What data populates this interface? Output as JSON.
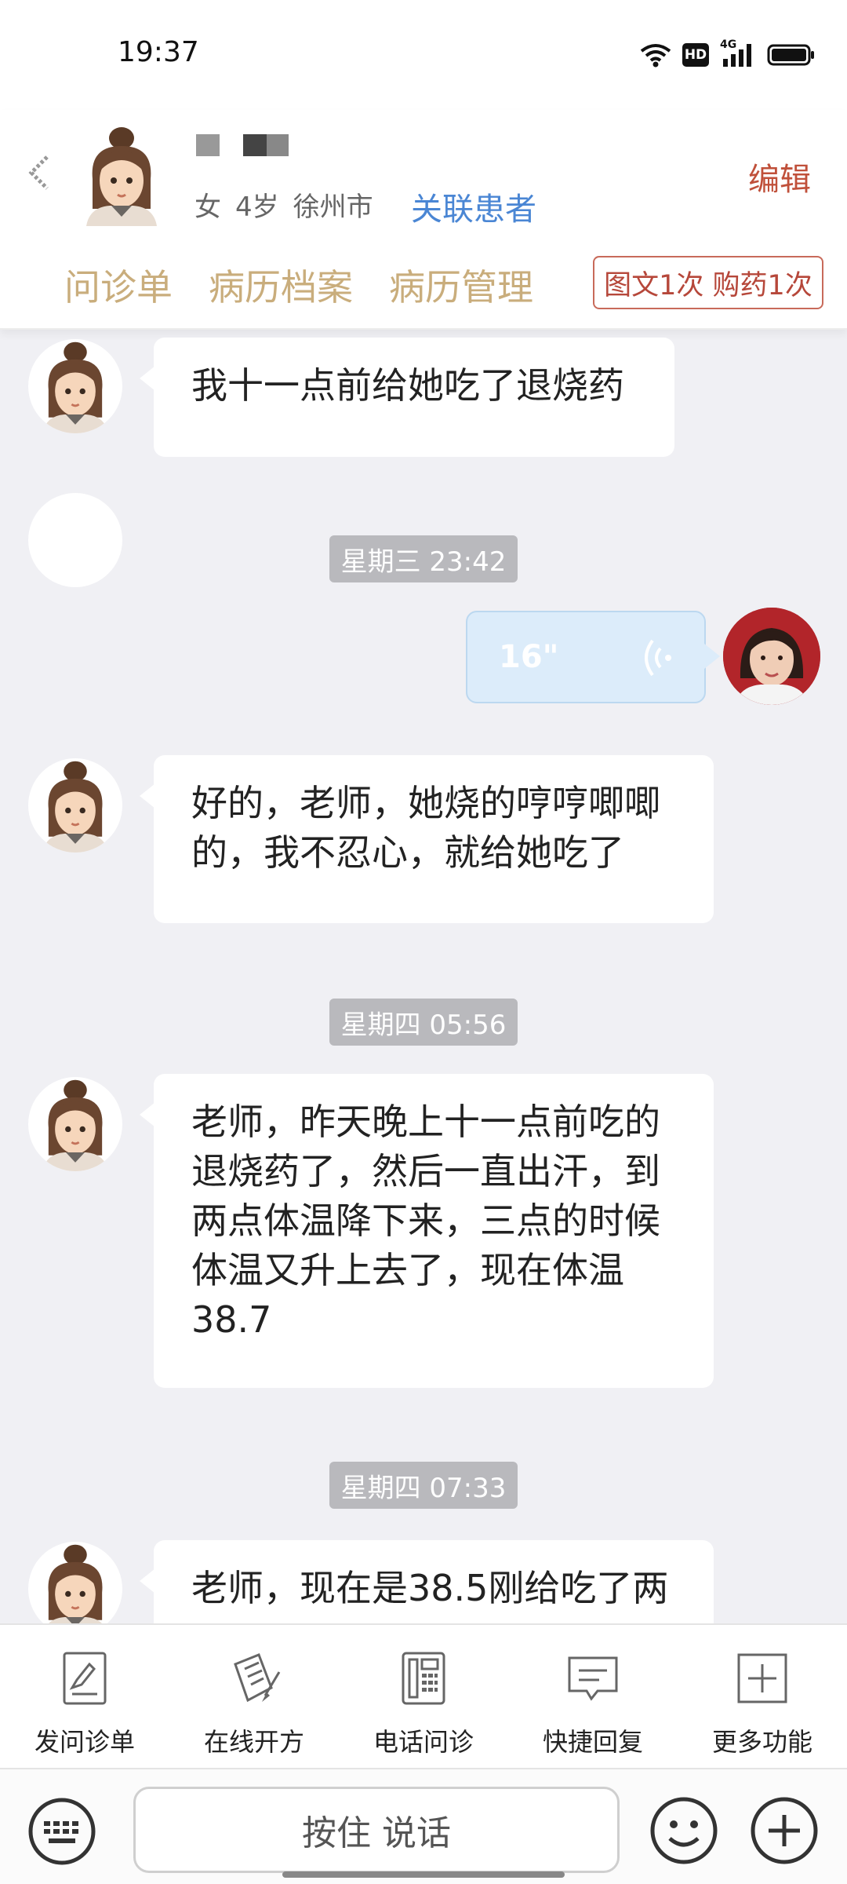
{
  "status_bar": {
    "time": "19:37",
    "icons": [
      "wifi-icon",
      "hd-icon",
      "signal-4g-icon",
      "battery-icon"
    ],
    "hd_label": "HD",
    "network_label": "4G"
  },
  "header": {
    "patient_gender": "女",
    "patient_age": "4岁",
    "patient_city": "徐州市",
    "link_patient_label": "关联患者",
    "edit_label": "编辑",
    "tabs": [
      {
        "label": "问诊单"
      },
      {
        "label": "病历档案"
      },
      {
        "label": "病历管理"
      }
    ],
    "service_badge": "图文1次 购药1次"
  },
  "chat": {
    "messages": [
      {
        "sender": "patient",
        "type": "text",
        "text_lines": [
          "我十一点前给她吃了退烧药"
        ]
      },
      {
        "type": "time",
        "text": "星期三 23:42"
      },
      {
        "sender": "doctor",
        "type": "voice",
        "duration": "16\""
      },
      {
        "sender": "patient",
        "type": "text",
        "text_lines": [
          "好的，老师，她烧的哼哼唧唧",
          "的，我不忍心，就给她吃了"
        ]
      },
      {
        "type": "time",
        "text": "星期四 05:56"
      },
      {
        "sender": "patient",
        "type": "text",
        "text_lines": [
          "老师，昨天晚上十一点前吃的",
          "退烧药了，然后一直出汗，到",
          "两点体温降下来，三点的时候",
          "体温又升上去了，现在体温",
          "38.7"
        ]
      },
      {
        "type": "time",
        "text": "星期四 07:33"
      },
      {
        "sender": "patient",
        "type": "text",
        "text_lines": [
          "老师，现在是38.5刚给吃了两"
        ]
      }
    ]
  },
  "function_bar": {
    "items": [
      {
        "label": "发问诊单",
        "icon": "questionnaire-icon"
      },
      {
        "label": "在线开方",
        "icon": "prescription-icon"
      },
      {
        "label": "电话问诊",
        "icon": "phone-icon"
      },
      {
        "label": "快捷回复",
        "icon": "quick-reply-icon"
      },
      {
        "label": "更多功能",
        "icon": "more-icon"
      }
    ]
  },
  "input_bar": {
    "hold_to_talk_label": "按住 说话"
  },
  "colors": {
    "accent_gold": "#c9ad7c",
    "accent_red": "#c0503a",
    "link_blue": "#4a86d4",
    "chat_bg": "#f0f0f4"
  }
}
